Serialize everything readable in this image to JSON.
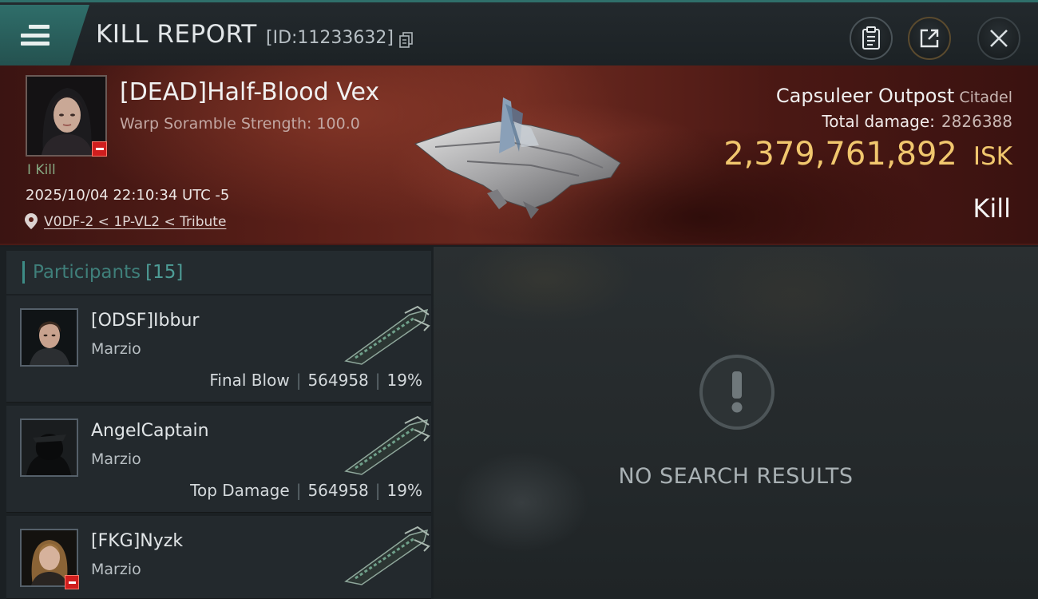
{
  "header": {
    "title": "KILL REPORT",
    "report_id": "[ID:11233632]"
  },
  "victim": {
    "name": "[DEAD]Half-Blood Vex",
    "warp_strength": "Warp Soramble Strength: 100.0",
    "kill_count": "I Kill",
    "timestamp": "2025/10/04 22:10:34 UTC -5",
    "location": "V0DF-2 < 1P-VL2 < Tribute"
  },
  "target": {
    "name": "Capsuleer Outpost",
    "class": "Citadel",
    "damage_label": "Total damage:",
    "damage_value": "2826388",
    "isk_value": "2,379,761,892",
    "isk_currency": "ISK",
    "result": "Kill"
  },
  "participants": {
    "label": "Participants",
    "count": "[15]",
    "items": [
      {
        "name": "[ODSF]Ibbur",
        "corp": "Marzio",
        "role": "Final Blow",
        "damage": "564958",
        "percent": "19%"
      },
      {
        "name": "AngelCaptain",
        "corp": "Marzio",
        "role": "Top Damage",
        "damage": "564958",
        "percent": "19%"
      },
      {
        "name": "[FKG]Nyzk",
        "corp": "Marzio",
        "role": "",
        "damage": "",
        "percent": ""
      }
    ]
  },
  "results_panel": {
    "empty_text": "NO SEARCH RESULTS"
  },
  "colors": {
    "accent_teal": "#2f6e6a",
    "isk_gold": "#f1c76e",
    "badge_red": "#d01e1e"
  },
  "icons": [
    "menu-icon",
    "copy-icon",
    "clipboard-icon",
    "share-icon",
    "close-icon",
    "location-pin-icon",
    "exclamation-icon"
  ]
}
